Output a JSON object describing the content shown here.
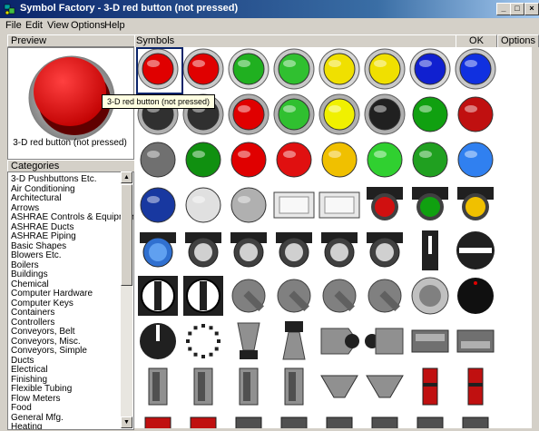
{
  "window": {
    "title": "Symbol Factory - 3-D red button (not pressed)",
    "controls": [
      "_",
      "□",
      "×"
    ]
  },
  "menu": [
    {
      "label": "File"
    },
    {
      "label": "Edit"
    },
    {
      "label": "View"
    },
    {
      "label": "Options"
    },
    {
      "label": "Help"
    }
  ],
  "preview": {
    "header": "Preview",
    "caption": "3-D red button (not pressed)",
    "tooltip": "3-D red button (not pressed)"
  },
  "categories": {
    "header": "Categories",
    "items": [
      "3-D Pushbuttons Etc.",
      "Air Conditioning",
      "Architectural",
      "Arrows",
      "ASHRAE Controls & Equipment",
      "ASHRAE Ducts",
      "ASHRAE Piping",
      "Basic Shapes",
      "Blowers Etc.",
      "Boilers",
      "Buildings",
      "Chemical",
      "Computer Hardware",
      "Computer Keys",
      "Containers",
      "Controllers",
      "Conveyors, Belt",
      "Conveyors, Misc.",
      "Conveyors, Simple",
      "Ducts",
      "Electrical",
      "Finishing",
      "Flexible Tubing",
      "Flow Meters",
      "Food",
      "General Mfg.",
      "Heating"
    ]
  },
  "symbols": {
    "header": "Symbols",
    "ok_label": "OK",
    "options_label": "Options"
  },
  "colors": {
    "titlebar_start": "#0a246a",
    "titlebar_end": "#a6caf0",
    "selection": "#0a246a"
  }
}
